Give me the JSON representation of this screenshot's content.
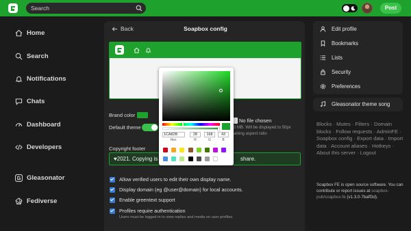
{
  "topbar": {
    "search_placeholder": "Search",
    "post_label": "Post"
  },
  "nav": {
    "items": [
      {
        "label": "Home",
        "icon": "home-icon"
      },
      {
        "label": "Search",
        "icon": "search-icon"
      },
      {
        "label": "Notifications",
        "icon": "bell-icon"
      },
      {
        "label": "Chats",
        "icon": "chat-icon"
      },
      {
        "label": "Dashboard",
        "icon": "dashboard-icon"
      },
      {
        "label": "Developers",
        "icon": "code-icon"
      },
      {
        "label": "Gleasonator",
        "icon": "logo-icon"
      },
      {
        "label": "Fediverse",
        "icon": "fediverse-icon"
      }
    ]
  },
  "config": {
    "back_label": "Back",
    "title": "Soapbox config",
    "brand_color_label": "Brand color",
    "default_theme_label": "Default theme",
    "file_status": "No file chosen",
    "file_hint_1": "2 MB. Will be displayed to 50px",
    "file_hint_2": "aining aspect ratio",
    "copyright_label": "Copyright footer",
    "copyright_left": "♥2021. Copying is a",
    "copyright_right": "share.",
    "checkboxes": [
      {
        "label": "Allow verified users to edit their own display name.",
        "checked": true
      },
      {
        "label": "Display domain (eg @user@domain) for local accounts.",
        "checked": true
      },
      {
        "label": "Enable greentext support",
        "checked": true
      },
      {
        "label": "Profiles require authentication",
        "checked": true
      }
    ],
    "auth_hint": "Users must be logged-in to view replies and media on user profiles."
  },
  "picker": {
    "hex": "1CA82B",
    "r": "28",
    "g": "168",
    "b": "43",
    "hex_label": "Hex",
    "r_label": "R",
    "g_label": "G",
    "b_label": "B",
    "preset_colors": [
      "#d0021b",
      "#f5a623",
      "#f8e71c",
      "#8b572a",
      "#7ed321",
      "#417505",
      "#bd10e0",
      "#9013fe",
      "#4a90e2",
      "#50e3c2",
      "#b8e986",
      "#000000",
      "#4a4a4a",
      "#9b9b9b",
      "#ffffff"
    ]
  },
  "right": {
    "menu": [
      "Edit profile",
      "Bookmarks",
      "Lists",
      "Security",
      "Preferences"
    ],
    "song": "Gleasonator theme song",
    "links": "Blocks · Mutes · Filters · Domain blocks · Follow requests · AdminFE · Soapbox config · Export data · Import data · Account aliases · Hotkeys · About this server · Logout",
    "about_1": "Soapbox FE is open source software. You can contribute or report issues at",
    "about_link": "soapbox-pub/soapbox-fe",
    "about_version": "(v1.3.0-7baff3d)."
  },
  "colors": {
    "brand": "#1fa12e",
    "accent": "#3ac24b"
  }
}
